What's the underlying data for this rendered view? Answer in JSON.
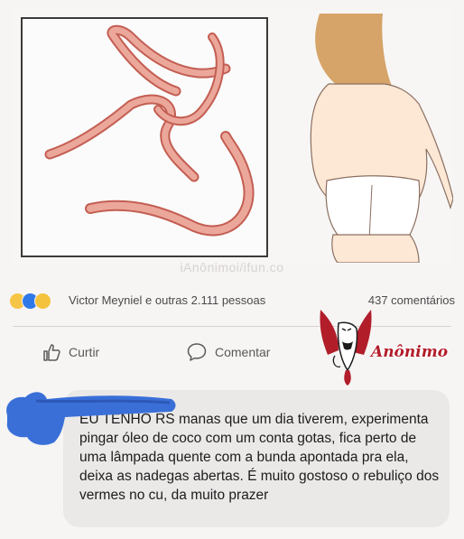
{
  "post": {
    "watermark": "iAnônimoi/ifun.co",
    "reactions": {
      "icons": [
        "haha-reaction-icon",
        "like-reaction-icon",
        "sad-reaction-icon"
      ],
      "names_text": "Victor Meyniel e outras 2.111 pessoas",
      "comments_text": "437 comentários"
    },
    "actions": {
      "like_label": "Curtir",
      "comment_label": "Comentar"
    },
    "logo_text": "Anônimo"
  },
  "comment": {
    "text": "EU TENHO RS manas que um dia tiverem, experimenta pingar óleo de coco com um conta gotas, fica perto de uma lâmpada quente com a bunda apontada pra ela, deixa as nadegas abertas. É muito gostoso o rebuliço dos vermes no cu, da muito prazer"
  },
  "colors": {
    "accent_blue": "#3a6fd8",
    "logo_red": "#b21d2a",
    "worm_fill": "#e79a8e",
    "worm_stroke": "#c35e52"
  }
}
